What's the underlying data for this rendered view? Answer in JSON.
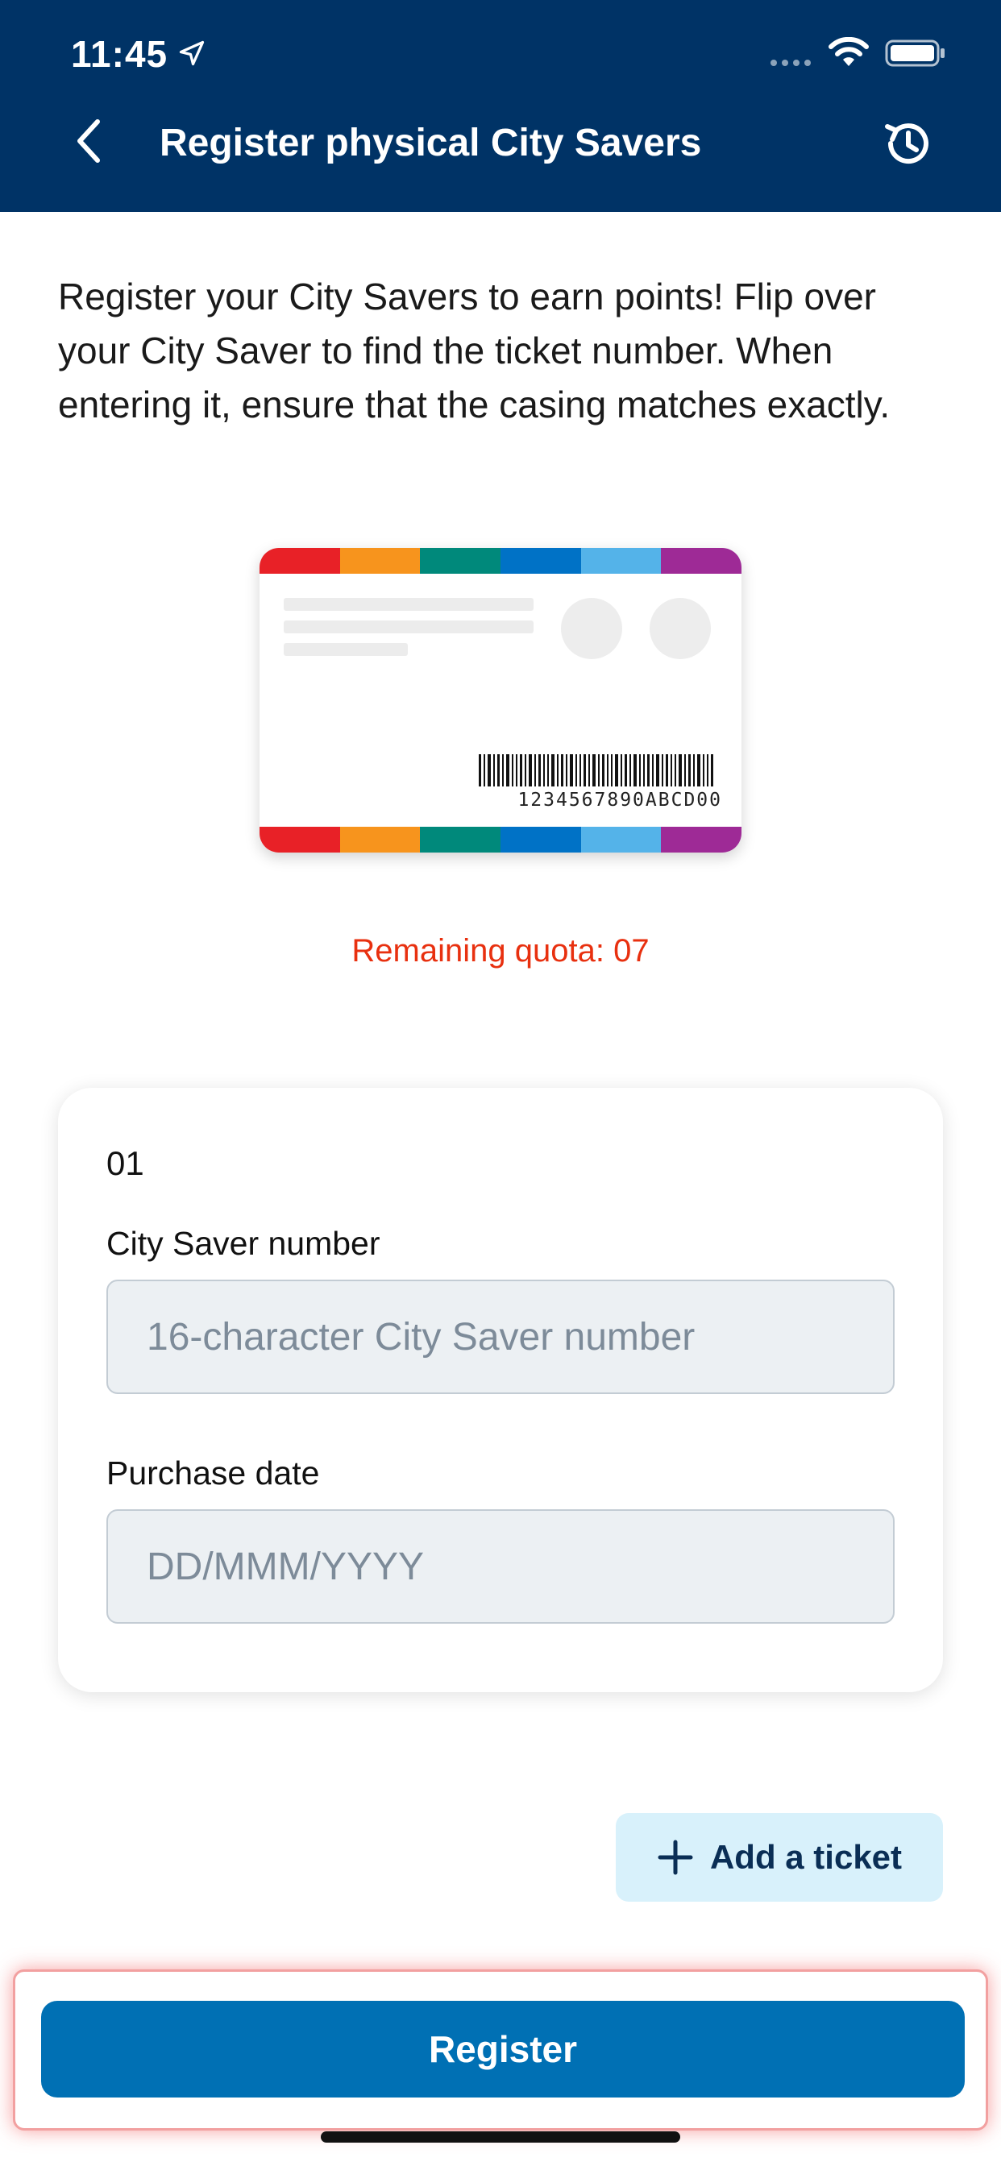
{
  "status": {
    "time": "11:45"
  },
  "header": {
    "title": "Register physical City Savers"
  },
  "intro": {
    "text": "Register your City Savers to earn points! Flip over your City Saver to find the ticket number. When entering it, ensure that the casing matches exactly."
  },
  "ticket_sample": {
    "barcode_number": "1234567890ABCD00",
    "stripe_colors": [
      "#e82127",
      "#f7941d",
      "#00897b",
      "#0072c6",
      "#54b3e9",
      "#9e2a96"
    ]
  },
  "quota": {
    "text": "Remaining quota: 07"
  },
  "form": {
    "index": "01",
    "number_label": "City Saver number",
    "number_placeholder": "16-character City Saver number",
    "date_label": "Purchase date",
    "date_placeholder": "DD/MMM/YYYY"
  },
  "actions": {
    "add_ticket": "Add a ticket",
    "register": "Register"
  },
  "colors": {
    "header_bg": "#003366",
    "accent": "#0070b4",
    "quota": "#e8300f"
  },
  "icons": {
    "back": "chevron-left-icon",
    "history": "history-icon",
    "add": "plus-icon"
  }
}
